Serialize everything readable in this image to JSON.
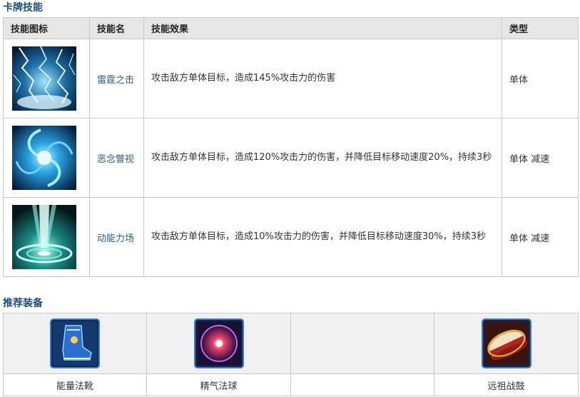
{
  "skills_section": {
    "title": "卡牌技能",
    "headers": {
      "icon": "技能图标",
      "name": "技能名",
      "effect": "技能效果",
      "type": "类型"
    },
    "rows": [
      {
        "icon": "lightning-strike-icon",
        "name": "雷霆之击",
        "effect": "攻击敌方单体目标，造成145%攻击力的伤害",
        "type": "单体"
      },
      {
        "icon": "malice-gaze-icon",
        "name": "恶念瞥视",
        "effect": "攻击敌方单体目标，造成120%攻击力的伤害，并降低目标移动速度20%，持续3秒",
        "type": "单体  减速"
      },
      {
        "icon": "kinetic-field-icon",
        "name": "动能力场",
        "effect": "攻击敌方单体目标，造成10%攻击力的伤害，并降低目标移动速度30%，持续3秒",
        "type": "单体  减速"
      }
    ]
  },
  "gear_section": {
    "title": "推荐装备",
    "items": [
      {
        "icon": "energy-boots-icon",
        "label": "能量法靴"
      },
      {
        "icon": "essence-orb-icon",
        "label": "精气法球"
      },
      {
        "icon": "",
        "label": ""
      },
      {
        "icon": "ancestral-war-drum-icon",
        "label": "远祖战鼓"
      }
    ]
  },
  "colors": {
    "title": "#1f4e7a",
    "skill_name": "#2b5d8c",
    "header_bg": "#e6e6e6",
    "border": "#c9c9c9"
  }
}
